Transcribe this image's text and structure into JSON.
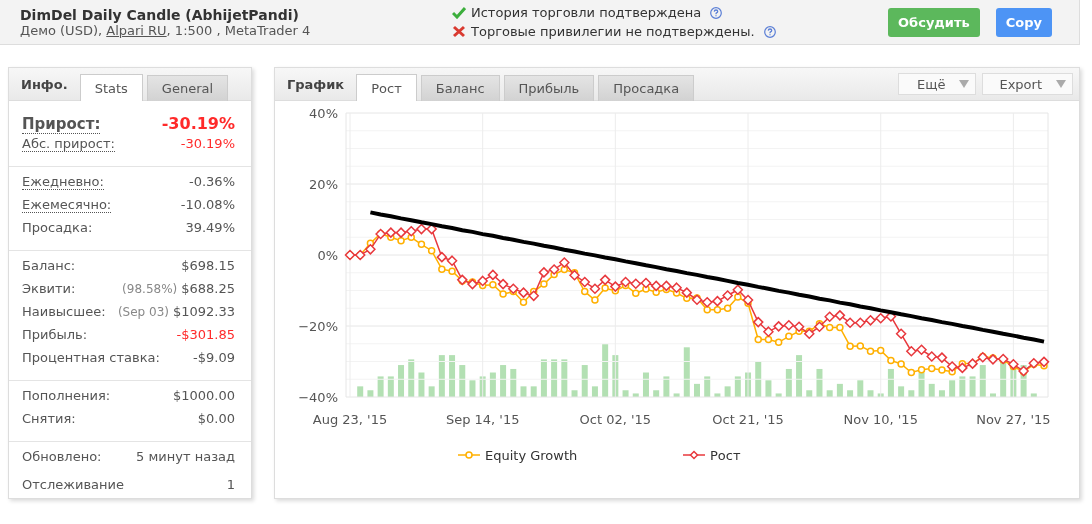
{
  "header": {
    "title": "DimDel Daily Candle (AbhijetPandi)",
    "subtitle_prefix": "Демо (USD), ",
    "broker_link": "Alpari RU",
    "subtitle_suffix": ", 1:500 , MetaTrader 4",
    "verifications": [
      {
        "text": "История торговли подтверждена",
        "verified": true
      },
      {
        "text": "Торговые привилегии не подтверждены.",
        "verified": false
      }
    ],
    "buttons": [
      {
        "label": "Обсудить",
        "color": "#5cb85c"
      },
      {
        "label": "Copy",
        "color": "#4d94f5"
      }
    ]
  },
  "info_panel": {
    "heading": "Инфо.",
    "tabs": [
      {
        "label": "Stats",
        "selected": true
      },
      {
        "label": "General",
        "selected": false
      }
    ],
    "groups": [
      [
        {
          "label": "Прирост:",
          "value": "-30.19%",
          "kind": "headline",
          "dotted": true,
          "negative": true
        },
        {
          "label": "Абс. прирост:",
          "value": "-30.19%",
          "kind": "row",
          "dotted": true,
          "negative": true
        }
      ],
      [
        {
          "label": "Ежедневно:",
          "value": "-0.36%",
          "kind": "row",
          "dotted": true,
          "negative": false
        },
        {
          "label": "Ежемесячно:",
          "value": "-10.08%",
          "kind": "row",
          "dotted": true,
          "negative": false
        },
        {
          "label": "Просадка:",
          "value": "39.49%",
          "kind": "row",
          "dotted": false,
          "negative": false
        }
      ],
      [
        {
          "label": "Баланс:",
          "value": "$698.15",
          "kind": "row",
          "dotted": false,
          "negative": false
        },
        {
          "label": "Эквити:",
          "note": "(98.58%)",
          "value": "$688.25",
          "kind": "row",
          "dotted": false,
          "negative": false
        },
        {
          "label": "Наивысшее:",
          "note": "(Sep 03)",
          "value": "$1092.33",
          "kind": "row",
          "dotted": false,
          "negative": false
        },
        {
          "label": "Прибыль:",
          "value": "-$301.85",
          "kind": "row",
          "dotted": false,
          "negative": true
        },
        {
          "label": "Процентная ставка:",
          "value": "-$9.09",
          "kind": "row",
          "dotted": false,
          "negative": false
        }
      ],
      [
        {
          "label": "Пополнения:",
          "value": "$1000.00",
          "kind": "row",
          "dotted": false,
          "negative": false
        },
        {
          "label": "Снятия:",
          "value": "$0.00",
          "kind": "row",
          "dotted": false,
          "negative": false
        }
      ],
      [
        {
          "label": "Обновлено:",
          "value": "5 минут назад",
          "kind": "tall",
          "dotted": false,
          "negative": false
        },
        {
          "label": "Отслеживание",
          "value": "1",
          "kind": "tall",
          "dotted": false,
          "negative": false
        }
      ]
    ]
  },
  "chart_panel": {
    "heading": "График",
    "tabs": [
      {
        "label": "Рост",
        "selected": true
      },
      {
        "label": "Баланс",
        "selected": false
      },
      {
        "label": "Прибыль",
        "selected": false
      },
      {
        "label": "Просадка",
        "selected": false
      }
    ],
    "menus": [
      "Ещё",
      "Export"
    ],
    "chart_data": {
      "type": "line",
      "ylim": [
        -40,
        40
      ],
      "yticks": [
        {
          "value": 40,
          "label": "40%"
        },
        {
          "value": 20,
          "label": "20%"
        },
        {
          "value": 0,
          "label": "0%"
        },
        {
          "value": -20,
          "label": "−20%"
        },
        {
          "value": -40,
          "label": "−40%"
        }
      ],
      "grid": true,
      "legend": "bottom",
      "categories": [
        "Aug 23, '15",
        null,
        null,
        null,
        null,
        null,
        null,
        null,
        null,
        null,
        null,
        null,
        null,
        "Sep 14, '15",
        null,
        null,
        null,
        null,
        null,
        null,
        null,
        null,
        null,
        null,
        null,
        null,
        "Oct 02, '15",
        null,
        null,
        null,
        null,
        null,
        null,
        null,
        null,
        null,
        null,
        null,
        null,
        "Oct 21, '15",
        null,
        null,
        null,
        null,
        null,
        null,
        null,
        null,
        null,
        null,
        null,
        null,
        "Nov 10, '15",
        null,
        null,
        null,
        null,
        null,
        null,
        null,
        null,
        null,
        null,
        null,
        null,
        "Nov 27, '15",
        null,
        null,
        null
      ],
      "series": [
        {
          "name": "Equity Growth",
          "marker": "circle",
          "color": "#ffb000",
          "values": [
            0,
            0,
            3.3,
            6,
            5,
            4,
            5,
            3,
            1.2,
            -4,
            -4.6,
            -7.3,
            -7.6,
            -8.6,
            -8.4,
            -11,
            -10.3,
            -13.3,
            -10.3,
            -8.2,
            -5.5,
            -4.1,
            -5,
            -10.3,
            -12.7,
            -9.3,
            -10.1,
            -8.6,
            -10.8,
            -9.6,
            -10.5,
            -9.7,
            -10.7,
            -12.2,
            -12.1,
            -15.4,
            -15.4,
            -15,
            -11.8,
            -13.6,
            -23.8,
            -23.8,
            -24.6,
            -22.9,
            -21.5,
            -21.5,
            -19.4,
            -20.4,
            -20.4,
            -25.7,
            -25.6,
            -27.1,
            -26.9,
            -29.7,
            -30.7,
            -33.1,
            -32.3,
            -32,
            -32.4,
            -32.9,
            -30.6,
            -30.6,
            -28.6,
            -29,
            -29.6,
            -31.4,
            -32.9,
            -30.8,
            -31.2
          ]
        },
        {
          "name": "Рост",
          "marker": "diamond",
          "color": "#e8383d",
          "values": [
            0,
            0,
            1.6,
            5.9,
            6.3,
            6.3,
            6.7,
            7.3,
            7.3,
            -0.6,
            -1.6,
            -7,
            -8.2,
            -7.3,
            -5.6,
            -8.2,
            -9.5,
            -10.6,
            -11.5,
            -4.9,
            -4.1,
            -2.1,
            -5.7,
            -7.6,
            -9.5,
            -7,
            -8.9,
            -7.6,
            -8.1,
            -7.9,
            -8.7,
            -8.7,
            -9.2,
            -10.6,
            -12.6,
            -13.3,
            -13,
            -11.4,
            -9.8,
            -12.7,
            -18.9,
            -21.6,
            -20.1,
            -19.8,
            -20.2,
            -22.2,
            -20.2,
            -17.4,
            -17,
            -19.1,
            -19.1,
            -18.4,
            -17.8,
            -17.3,
            -22.2,
            -27.1,
            -26.7,
            -28.6,
            -28.9,
            -31.4,
            -31.8,
            -30.6,
            -28.8,
            -29.4,
            -29.3,
            -30.8,
            -32.7,
            -30.5,
            -30.1
          ]
        },
        {
          "color": "#000000",
          "values": [
            null,
            null,
            12.0,
            11.4,
            10.9,
            10.3,
            9.8,
            9.2,
            8.7,
            8.1,
            7.6,
            7.0,
            6.5,
            5.9,
            5.4,
            4.8,
            4.3,
            3.7,
            3.2,
            2.6,
            2.1,
            1.5,
            1.0,
            0.4,
            -0.1,
            -0.7,
            -1.2,
            -1.8,
            -2.3,
            -2.9,
            -3.4,
            -4.0,
            -4.5,
            -5.1,
            -5.6,
            -6.2,
            -6.7,
            -7.3,
            -7.9,
            -8.4,
            -9.0,
            -9.5,
            -10.1,
            -10.6,
            -11.2,
            -11.7,
            -12.3,
            -12.8,
            -13.4,
            -13.9,
            -14.5,
            -15.0,
            -15.6,
            -16.1,
            -16.7,
            -17.2,
            -17.8,
            -18.3,
            -18.9,
            -19.4,
            -20.0,
            -20.5,
            -21.1,
            -21.6,
            -22.2,
            -22.7,
            -23.3,
            -23.8,
            -24.4
          ]
        }
      ]
    }
  }
}
